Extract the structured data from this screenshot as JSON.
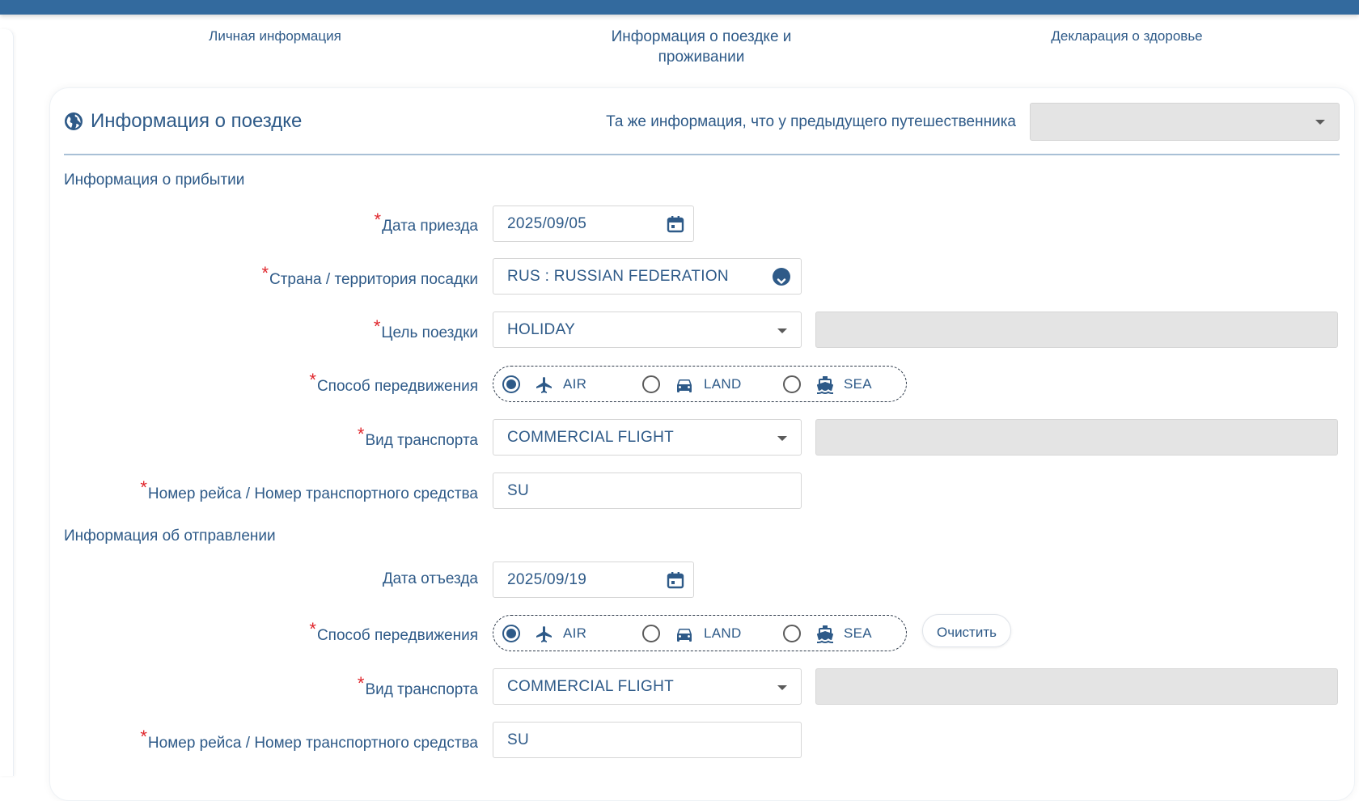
{
  "steps": {
    "step1": "Личная информация",
    "step2_line1": "Информация о поездке и",
    "step2_line2": "проживании",
    "step3": "Декларация о здоровье"
  },
  "card": {
    "title": "Информация о поездке",
    "same_as_previous_label": "Та же информация, что у предыдущего путешественника",
    "same_as_previous_value": ""
  },
  "arrival": {
    "section_title": "Информация о прибытии",
    "date_label": "Дата приезда",
    "date_value": "2025/09/05",
    "country_label": "Страна / территория посадки",
    "country_value": "RUS : RUSSIAN FEDERATION",
    "purpose_label": "Цель поездки",
    "purpose_value": "HOLIDAY",
    "mode_label": "Способ передвижения",
    "modes": [
      "AIR",
      "LAND",
      "SEA"
    ],
    "mode_selected": "AIR",
    "transport_label": "Вид транспорта",
    "transport_value": "COMMERCIAL FLIGHT",
    "flight_label": "Номер рейса / Номер транспортного средства",
    "flight_value": "SU"
  },
  "departure": {
    "section_title": "Информация об отправлении",
    "date_label": "Дата отъезда",
    "date_value": "2025/09/19",
    "mode_label": "Способ передвижения",
    "modes": [
      "AIR",
      "LAND",
      "SEA"
    ],
    "mode_selected": "AIR",
    "clear_label": "Очистить",
    "transport_label": "Вид транспорта",
    "transport_value": "COMMERCIAL FLIGHT",
    "flight_label": "Номер рейса / Номер транспортного средства",
    "flight_value": "SU"
  },
  "required_mark": "*",
  "colors": {
    "header": "#336a9e",
    "text": "#2e5a88",
    "required": "#e0262c",
    "disabled": "#e4e4e4"
  }
}
